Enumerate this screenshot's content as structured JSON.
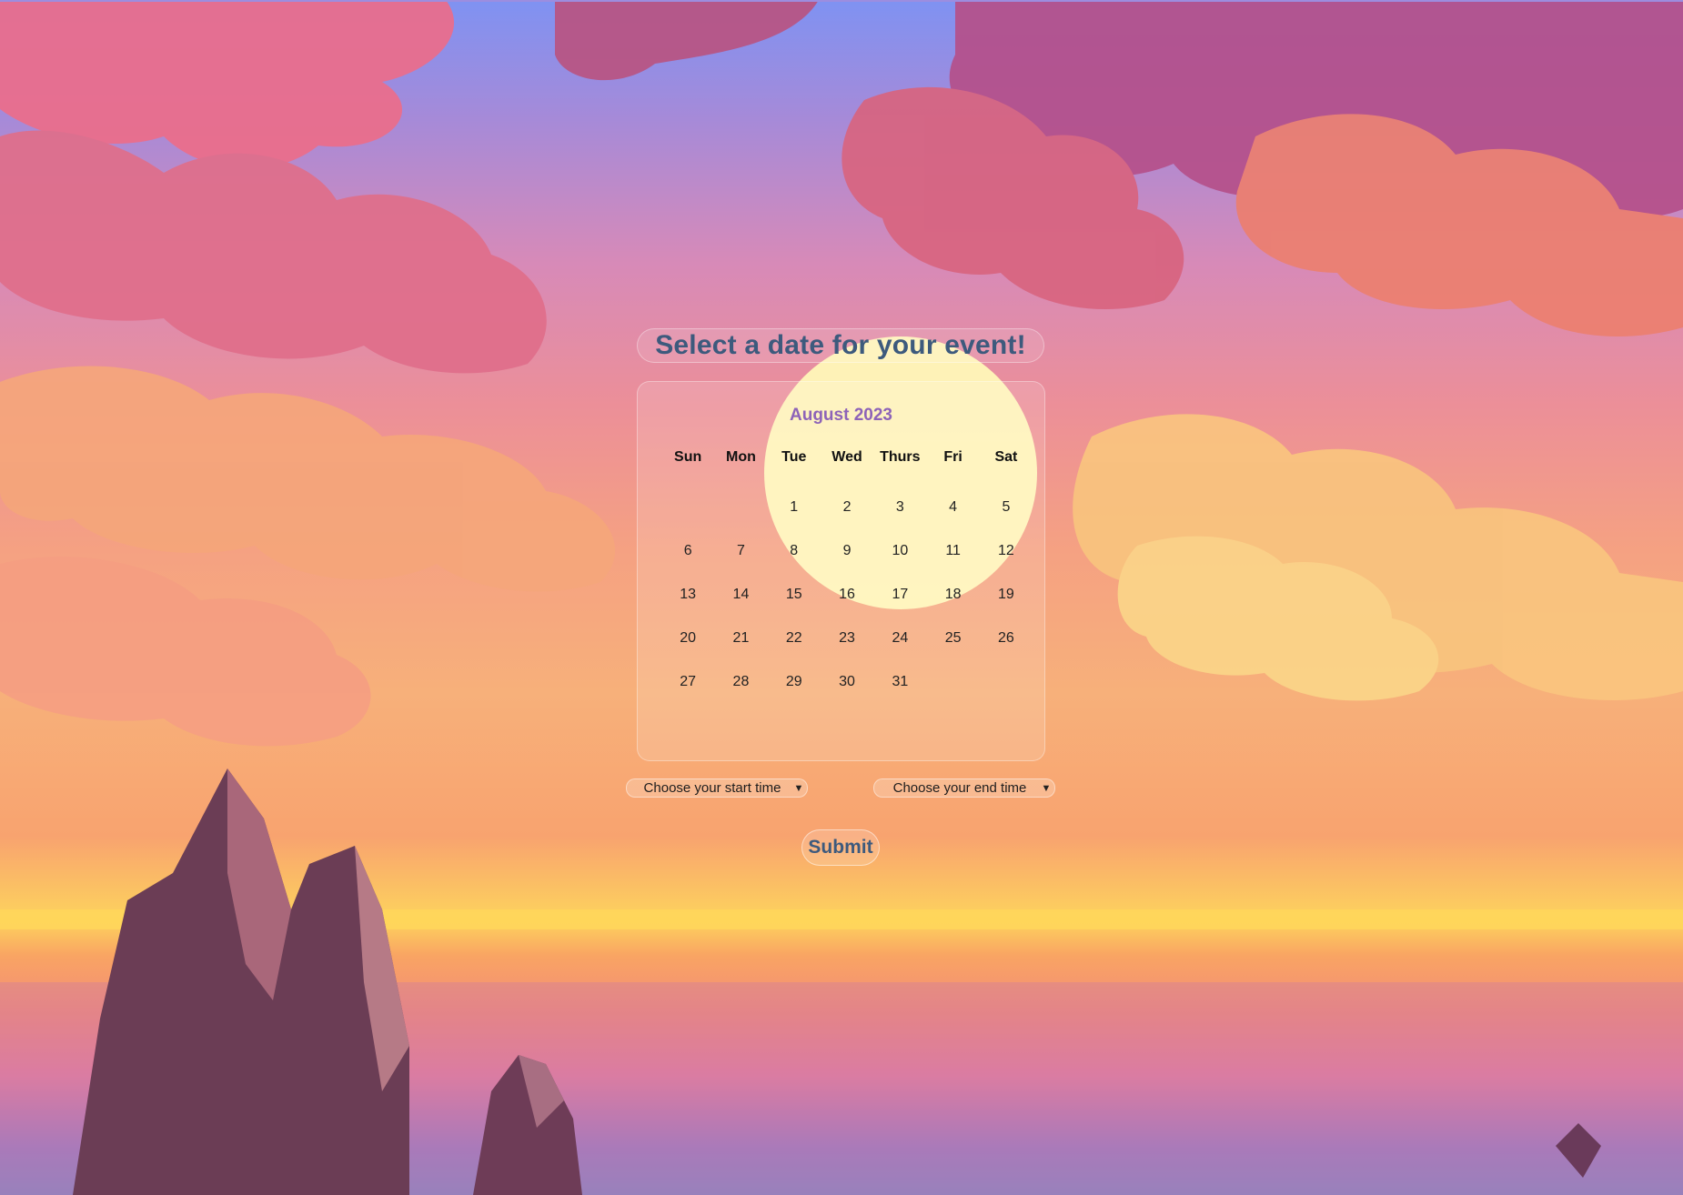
{
  "page": {
    "title": "Select a date for your event!"
  },
  "calendar": {
    "month_label": "August 2023",
    "weekdays": [
      "Sun",
      "Mon",
      "Tue",
      "Wed",
      "Thurs",
      "Fri",
      "Sat"
    ],
    "weeks": [
      [
        "",
        "",
        "1",
        "2",
        "3",
        "4",
        "5"
      ],
      [
        "6",
        "7",
        "8",
        "9",
        "10",
        "11",
        "12"
      ],
      [
        "13",
        "14",
        "15",
        "16",
        "17",
        "18",
        "19"
      ],
      [
        "20",
        "21",
        "22",
        "23",
        "24",
        "25",
        "26"
      ],
      [
        "27",
        "28",
        "29",
        "30",
        "31",
        "",
        ""
      ]
    ]
  },
  "time_selects": {
    "start": {
      "selected": "Choose your start time"
    },
    "end": {
      "selected": "Choose your end time"
    }
  },
  "submit": {
    "label": "Submit"
  },
  "colors": {
    "title_text": "#3d5a7d",
    "month_text": "#8d63b8",
    "sky_top": "#7f92f2",
    "sun": "#ffffbf"
  },
  "icons": {
    "select_chevron": "chevron-down-icon"
  }
}
